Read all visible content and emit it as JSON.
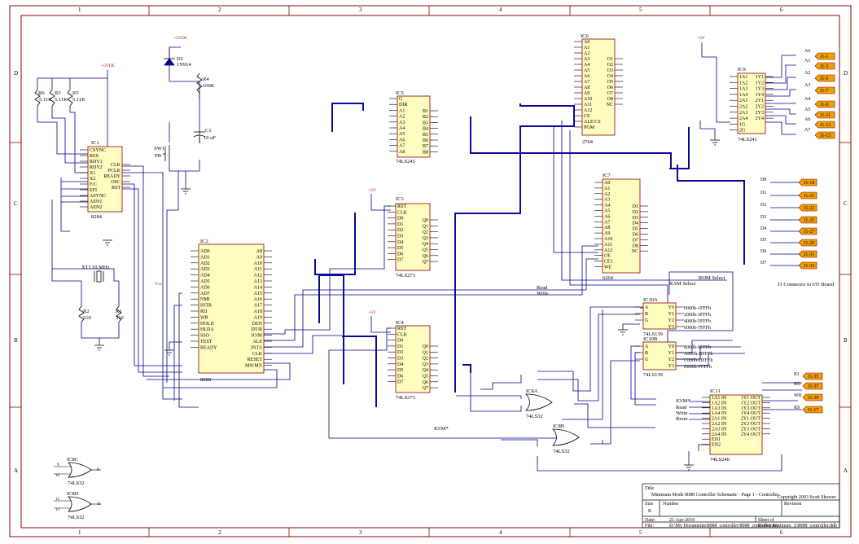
{
  "colors": {
    "frame": "#8b0000",
    "chip_fill": "#fffcc0",
    "chip_stroke": "#8b0000",
    "wire": "#00008b",
    "bus": "#0a0a9a",
    "connector": "#f0a000",
    "text": "#000000"
  },
  "grid": {
    "cols": [
      "1",
      "2",
      "3",
      "4",
      "5",
      "6"
    ],
    "rows": [
      "D",
      "C",
      "B",
      "A"
    ]
  },
  "chips": [
    {
      "ref": "IC1",
      "part": "8284",
      "pins": [
        "CSYNC",
        "RES",
        "RDY1",
        "RDY2",
        "X1",
        "X2",
        "F/C",
        "EFI",
        "ASYNC",
        "AEN1",
        "AEN2",
        "CLK",
        "PCLK",
        "READY",
        "OSC",
        "RST",
        "GND",
        "VCC"
      ]
    },
    {
      "ref": "IC2",
      "part": "8088",
      "pins": [
        "AD0",
        "AD1",
        "AD2",
        "AD3",
        "AD4",
        "AD5",
        "AD6",
        "AD7",
        "NMI",
        "INTR",
        "RD",
        "WR",
        "HOLD",
        "HLDA",
        "SSO",
        "TEST",
        "READY",
        "A8",
        "A9",
        "A10",
        "A11",
        "A12",
        "A13",
        "A14",
        "A15",
        "A16",
        "A17",
        "A18",
        "A19",
        "DEN",
        "DT/R",
        "IO/M",
        "ALE",
        "INTA",
        "CLK",
        "RESET",
        "MN/MX"
      ]
    },
    {
      "ref": "IC3",
      "part": "74LS273",
      "pins": [
        "RST",
        "CLK",
        "D0",
        "D1",
        "D2",
        "D3",
        "D4",
        "D5",
        "D6",
        "D7",
        "Q0",
        "Q1",
        "Q2",
        "Q3",
        "Q4",
        "Q5",
        "Q6",
        "Q7"
      ]
    },
    {
      "ref": "IC4",
      "part": "74LS273",
      "pins": [
        "RST",
        "CLK",
        "D0",
        "D1",
        "D2",
        "D3",
        "D4",
        "D5",
        "D6",
        "D7",
        "Q0",
        "Q1",
        "Q2",
        "Q3",
        "Q4",
        "Q5",
        "Q6",
        "Q7"
      ]
    },
    {
      "ref": "IC5",
      "part": "74LS245",
      "pins": [
        "G",
        "DIR",
        "A1",
        "A2",
        "A3",
        "A4",
        "A5",
        "A6",
        "A7",
        "A8",
        "B1",
        "B2",
        "B3",
        "B4",
        "B5",
        "B6",
        "B7",
        "B8"
      ]
    },
    {
      "ref": "IC6",
      "part": "2764",
      "pins": [
        "A0",
        "A1",
        "A2",
        "A3",
        "A4",
        "A5",
        "A6",
        "A7",
        "A8",
        "A9",
        "A10",
        "A11",
        "A12",
        "CE",
        "ALE/CS",
        "PGM",
        "O1",
        "O2",
        "O3",
        "O4",
        "O5",
        "O6",
        "O7",
        "O8",
        "NC"
      ]
    },
    {
      "ref": "IC7",
      "part": "6264",
      "pins": [
        "A0",
        "A1",
        "A2",
        "A3",
        "A4",
        "A5",
        "A6",
        "A7",
        "A8",
        "A9",
        "A10",
        "A11",
        "A12",
        "OE",
        "CE1",
        "WE",
        "D1",
        "D2",
        "D3",
        "D4",
        "D5",
        "D6",
        "D7",
        "D8",
        "NC"
      ]
    },
    {
      "ref": "IC9",
      "part": "74LS241",
      "pins": [
        "1A1",
        "1A2",
        "1A3",
        "1A4",
        "2A1",
        "2A2",
        "2A3",
        "2A4",
        "1G",
        "2G",
        "1Y1",
        "1Y2",
        "1Y3",
        "1Y4",
        "2Y1",
        "2Y2",
        "2Y3",
        "2Y4"
      ]
    },
    {
      "ref": "IC10A",
      "part": "74LS139",
      "pins": [
        "A",
        "B",
        "G",
        "Y0",
        "Y1",
        "Y2",
        "Y3"
      ]
    },
    {
      "ref": "IC10B",
      "part": "74LS139",
      "pins": [
        "A",
        "B",
        "G",
        "Y0",
        "Y1",
        "Y2",
        "Y3"
      ]
    },
    {
      "ref": "IC11",
      "part": "74LS240",
      "pins": [
        "1A1 IN",
        "1A2 IN",
        "1A3 IN",
        "1A4 IN",
        "2A1 IN",
        "2A2 IN",
        "2A3 IN",
        "2A4 IN",
        "EN1",
        "EN2",
        "1Y1 OUT",
        "1Y2 OUT",
        "1Y3 OUT",
        "1Y4 OUT",
        "2Y1 OUT",
        "2Y2 OUT",
        "2Y3 OUT",
        "2Y4 OUT"
      ]
    }
  ],
  "parts": {
    "d1": {
      "ref": "D1",
      "part": "1N914"
    },
    "r4": {
      "ref": "R4",
      "value": "100K"
    },
    "c1": {
      "ref": "C1",
      "value": "10 uF"
    },
    "sw1": {
      "ref": "SW1",
      "value": "PB"
    },
    "r_pullups": [
      {
        "ref": "R6",
        "value": "5.11K"
      },
      {
        "ref": "R3",
        "value": "5.11K"
      },
      {
        "ref": "R5",
        "value": "5.11K"
      }
    ],
    "xtal": {
      "ref": "XT1",
      "value": "10 MHz"
    },
    "r2": {
      "ref": "R2",
      "value": "510"
    },
    "r1": {
      "ref": "R1",
      "value": "510"
    },
    "gates": [
      {
        "ref": "IC8C",
        "part": "74LS32"
      },
      {
        "ref": "IC8D",
        "part": "74LS32"
      },
      {
        "ref": "IC8A",
        "part": "74LS32"
      },
      {
        "ref": "IC8B",
        "part": "74LS32"
      }
    ]
  },
  "power": {
    "vcc": "+5VDC",
    "v5": "+5V",
    "vcc_short": "Vcc"
  },
  "net_labels": {
    "rom_select": "ROM Select",
    "ram_select": "RAM Select",
    "read": "Read",
    "write": "Write",
    "io_m": "IO/M*",
    "reset": "Reset",
    "io_m2": "IO/M*"
  },
  "decode": {
    "a": [
      "0000h-1FFFh",
      "2000h-3FFFh",
      "4000h-5FFFh",
      "6000h-7FFFh"
    ],
    "b": [
      "8000h-9FFFh",
      "A000h-BFFFh",
      "C000h-DFFFh",
      "E000h-FFFFh"
    ]
  },
  "connectors": {
    "data_d": [
      "D0",
      "D1",
      "D2",
      "D3",
      "D4",
      "D5",
      "D6",
      "D7"
    ],
    "data_j": [
      "J1-19",
      "J1-21",
      "J1-23",
      "J1-25",
      "J1-27",
      "J1-29",
      "J1-31",
      "J1-33"
    ],
    "addr_a": [
      "A0",
      "A1",
      "A2",
      "A3",
      "A4",
      "A5",
      "A6",
      "A7"
    ],
    "addr_j": [
      "J1-1",
      "J1-3",
      "J1-5",
      "J1-7",
      "J1-9",
      "J1-11",
      "J1-13",
      "J1-15"
    ],
    "ctl_a": [
      "IO",
      "RD",
      "WR",
      "RS"
    ],
    "ctl_j": [
      "J1-35",
      "J1-37",
      "J1-39",
      "J1-17"
    ],
    "note": "J1 Connector to I/O Board"
  },
  "title_block": {
    "title_label": "Title",
    "title": "Minimum Mode 8088 Controller Schematic - Page 1 - Controller",
    "copyright": "Copyright 2003 Scott Shower",
    "size_label": "Size",
    "size": "B",
    "number_label": "Number",
    "revision_label": "Revision",
    "date_label": "Date:",
    "date": "21-Apr-2010",
    "sheet_label": "Sheet    of",
    "file_label": "File:",
    "file": "D:\\My Documents\\8088_controller\\8088_controller\\minimum_2\\8088_controller.ddb",
    "drawn_label": "Drawn By:"
  }
}
